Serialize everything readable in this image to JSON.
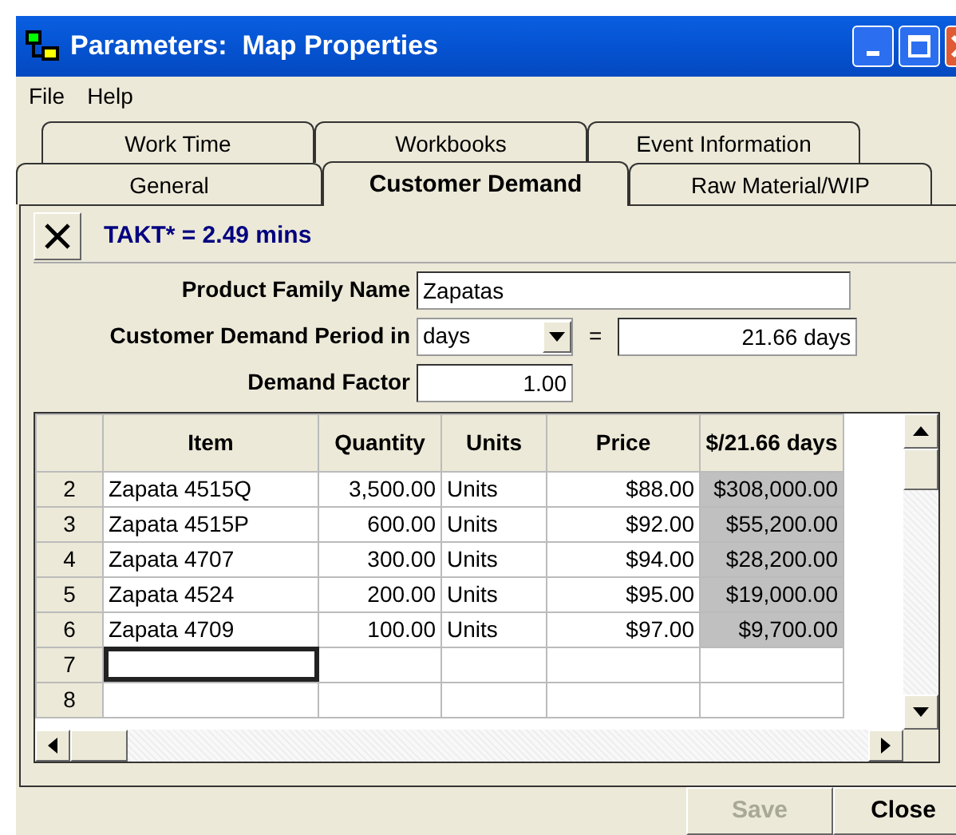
{
  "window": {
    "title": "Parameters:  Map Properties"
  },
  "menu": [
    "File",
    "Help"
  ],
  "tab_rows": [
    {
      "tabs": [
        {
          "label": "Work Time",
          "selected": false
        },
        {
          "label": "Workbooks",
          "selected": false
        },
        {
          "label": "Event Information",
          "selected": false
        }
      ]
    },
    {
      "tabs": [
        {
          "label": "General",
          "selected": false
        },
        {
          "label": "Customer Demand",
          "selected": true
        },
        {
          "label": "Raw Material/WIP",
          "selected": false
        }
      ]
    }
  ],
  "toolbar": {
    "takt": "TAKT* = 2.49 mins"
  },
  "product_family_name": {
    "label": "Product Family Name",
    "value": "Zapatas"
  },
  "demand_period": {
    "label": "Customer Demand Period in",
    "unit": "days",
    "equals": "=",
    "result": "21.66 days"
  },
  "demand_factor": {
    "label": "Demand Factor",
    "value": "1.00"
  },
  "grid": {
    "columns": [
      {
        "label": "Item",
        "kind": "text"
      },
      {
        "label": "Quantity",
        "kind": "number"
      },
      {
        "label": "Units",
        "kind": "text"
      },
      {
        "label": "Price",
        "kind": "number"
      },
      {
        "label": "$/21.66 days",
        "kind": "computed"
      }
    ],
    "rows": [
      {
        "row": "2",
        "cells": [
          "Zapata 4515Q",
          "3,500.00",
          "Units",
          "$88.00",
          "$308,000.00"
        ],
        "focused": false
      },
      {
        "row": "3",
        "cells": [
          "Zapata 4515P",
          "600.00",
          "Units",
          "$92.00",
          "$55,200.00"
        ],
        "focused": false
      },
      {
        "row": "4",
        "cells": [
          "Zapata 4707",
          "300.00",
          "Units",
          "$94.00",
          "$28,200.00"
        ],
        "focused": false
      },
      {
        "row": "5",
        "cells": [
          "Zapata 4524",
          "200.00",
          "Units",
          "$95.00",
          "$19,000.00"
        ],
        "focused": false
      },
      {
        "row": "6",
        "cells": [
          "Zapata 4709",
          "100.00",
          "Units",
          "$97.00",
          "$9,700.00"
        ],
        "focused": false
      },
      {
        "row": "7",
        "focused": true
      },
      {
        "row": "8",
        "focused": false
      }
    ]
  },
  "buttons": [
    {
      "label": "Save",
      "disabled": true
    },
    {
      "label": "Close",
      "disabled": false
    }
  ]
}
